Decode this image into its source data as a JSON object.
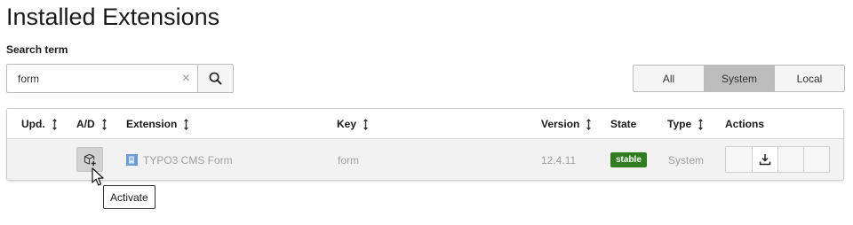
{
  "page": {
    "title": "Installed Extensions"
  },
  "search": {
    "label": "Search term",
    "value": "form",
    "clear_icon": "×"
  },
  "filters": {
    "items": [
      {
        "label": "All",
        "active": false
      },
      {
        "label": "System",
        "active": true
      },
      {
        "label": "Local",
        "active": false
      }
    ]
  },
  "table": {
    "headers": {
      "upd": "Upd.",
      "ad": "A/D",
      "extension": "Extension",
      "key": "Key",
      "version": "Version",
      "state": "State",
      "type": "Type",
      "actions": "Actions"
    },
    "rows": [
      {
        "extension": "TYPO3 CMS Form",
        "key": "form",
        "version": "12.4.11",
        "state": "stable",
        "type": "System"
      }
    ]
  },
  "tooltip": {
    "text": "Activate"
  },
  "colors": {
    "badge_stable": "#2f7d1f",
    "active_filter": "#bdbdbd",
    "row_bg": "#f2f2f2"
  },
  "icons": {
    "search": "search-icon",
    "clear": "close-icon",
    "sort": "sort-icon",
    "activate": "package-plus-icon",
    "extension": "extension-icon",
    "download": "download-icon"
  }
}
